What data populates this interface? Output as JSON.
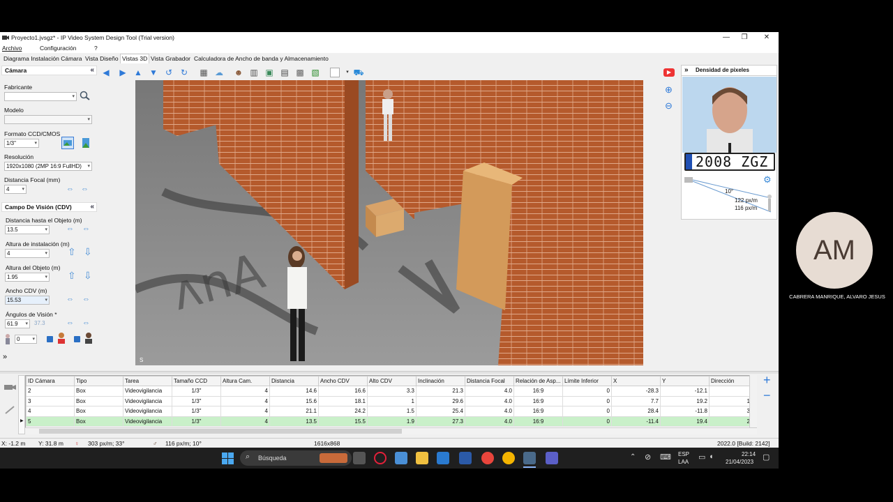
{
  "window": {
    "title": "Proyecto1.jvsgz* - IP Video System Design Tool (Trial version)",
    "minimize": "—",
    "maximize": "❐",
    "close": "✕"
  },
  "menu": {
    "archivo": "Archivo",
    "config": "Configuración",
    "help": "?"
  },
  "tabs": [
    "Diagrama Instalación Cámara",
    "Vista Diseño",
    "Vistas 3D",
    "Vista Grabador",
    "Calculadora de Ancho de banda y Almacenamiento"
  ],
  "camera_panel": {
    "header": "Cámara",
    "fabricante_label": "Fabricante",
    "fabricante_value": "",
    "modelo_label": "Modelo",
    "modelo_value": "",
    "formato_label": "Formato CCD/CMOS",
    "formato_value": "1/3\"",
    "resolucion_label": "Resolución",
    "resolucion_value": "1920x1080 (2MP 16:9 FullHD)",
    "focal_label": "Distancia Focal (mm)",
    "focal_value": "4"
  },
  "fov_panel": {
    "header": "Campo De Visión (CDV)",
    "distancia_label": "Distancia hasta el Objeto (m)",
    "distancia_value": "13.5",
    "altura_inst_label": "Altura de instalación (m)",
    "altura_inst_value": "4",
    "altura_obj_label": "Altura del Objeto (m)",
    "altura_obj_value": "1.95",
    "ancho_label": "Ancho CDV (m)",
    "ancho_value": "15.53",
    "angulos_label": "Ángulos de Visión *",
    "angulo_h": "61.9",
    "angulo_v": "37.3",
    "persons_value": "0"
  },
  "viewport": {
    "label": "S"
  },
  "density_panel": {
    "header": "Densidad de pixeles",
    "plate": "2008 ZGZ",
    "angle": "10°",
    "density1": "122 px/m",
    "density2": "116 px/m"
  },
  "grid": {
    "columns": [
      "ID Cámara",
      "Tipo",
      "Tarea",
      "Tamaño CCD",
      "Altura Cam.",
      "Distancia",
      "Ancho CDV",
      "Alto CDV",
      "Inclinación",
      "Distancia Focal",
      "Relación de Asp...",
      "Límite Inferior",
      "X",
      "Y",
      "Dirección"
    ],
    "rows": [
      [
        "2",
        "Box",
        "Videovigilancia",
        "1/3\"",
        "4",
        "14.6",
        "16.6",
        "3.3",
        "21.3",
        "4.0",
        "16:9",
        "0",
        "-28.3",
        "-12.1",
        ""
      ],
      [
        "3",
        "Box",
        "Videovigilancia",
        "1/3\"",
        "4",
        "15.6",
        "18.1",
        "1",
        "29.6",
        "4.0",
        "16:9",
        "0",
        "7.7",
        "19.2",
        "1"
      ],
      [
        "4",
        "Box",
        "Videovigilancia",
        "1/3\"",
        "4",
        "21.1",
        "24.2",
        "1.5",
        "25.4",
        "4.0",
        "16:9",
        "0",
        "28.4",
        "-11.8",
        "3"
      ],
      [
        "5",
        "Box",
        "Videovigilancia",
        "1/3\"",
        "4",
        "13.5",
        "15.5",
        "1.9",
        "27.3",
        "4.0",
        "16:9",
        "0",
        "-11.4",
        "19.4",
        "2"
      ]
    ],
    "selected_row": 3
  },
  "status": {
    "x": "X: -1.2 m",
    "y": "Y: 31.8 m",
    "d1": "303 px/m; 33°",
    "d2": "116 px/m; 10°",
    "res": "1616x868",
    "build": "2022.0 [Build: 2142]"
  },
  "taskbar": {
    "search": "Búsqueda",
    "lang1": "ESP",
    "lang2": "LAA",
    "time": "22:14",
    "date": "21/04/2023"
  },
  "participant": {
    "initials": "AM",
    "name": "CABRERA MANRIQUE, ALVARO JESUS"
  },
  "colors": {
    "accent": "#2f7ad8",
    "selected_row": "#c9f0c9",
    "brick": "#b4582c"
  }
}
